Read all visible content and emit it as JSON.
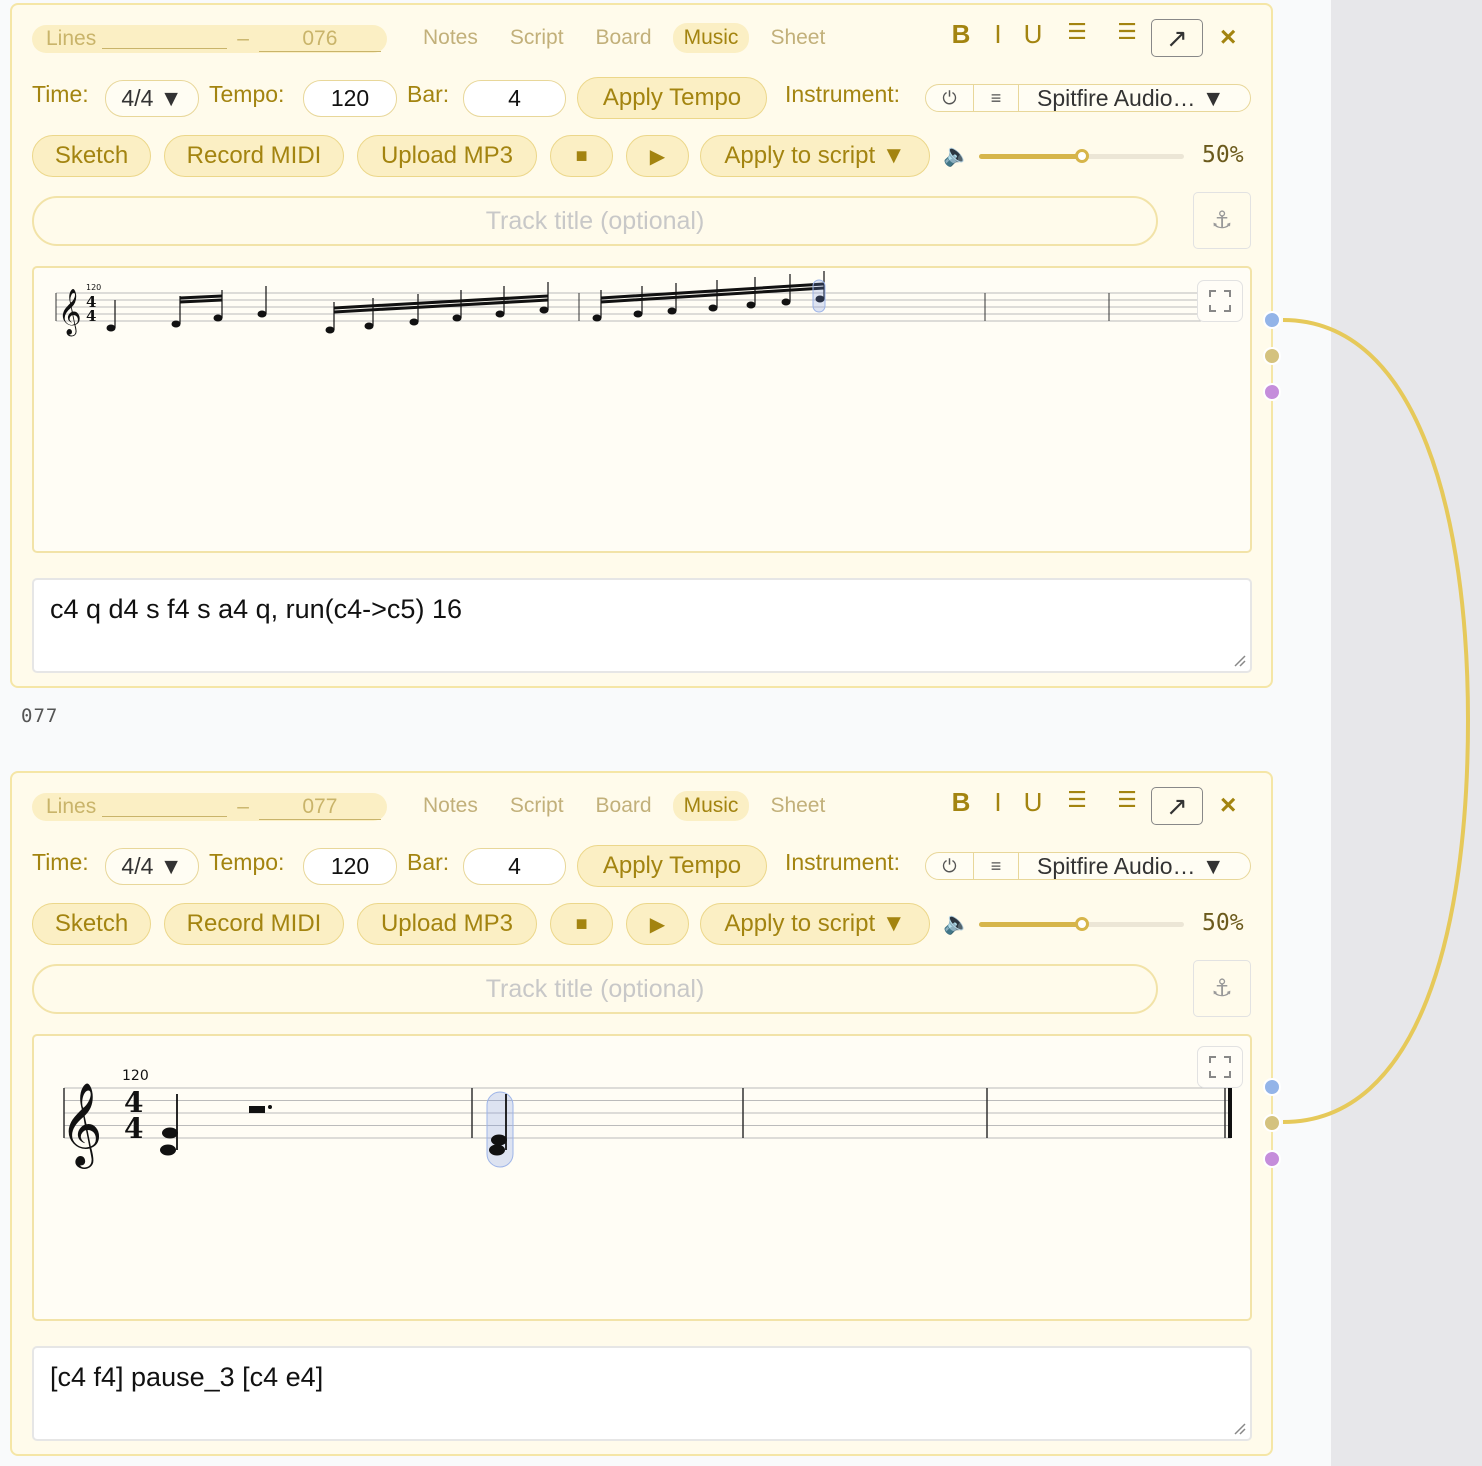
{
  "colors": {
    "accent": "#a38410",
    "pill_bg": "#fbefc4",
    "card_bg": "#fffbeb",
    "connector": "#e6c95a",
    "port_blue": "#93b4e8",
    "port_tan": "#d4c27e",
    "port_purple": "#c58ddb"
  },
  "between_label": "077",
  "cards": [
    {
      "lines_label": "Lines",
      "lines_dash": "–",
      "lines_number": "076",
      "tabs": [
        "Notes",
        "Script",
        "Board",
        "Music",
        "Sheet"
      ],
      "active_tab": "Music",
      "format": {
        "bold": "B",
        "italic": "I",
        "underline": "U",
        "bullet_list_icon": "☰",
        "numbered_list_icon": "☰",
        "popout_icon": "↗",
        "close_icon": "×"
      },
      "time_label": "Time:",
      "time_value": "4/4 ▼",
      "tempo_label": "Tempo:",
      "tempo_value": "120",
      "bar_label": "Bar:",
      "bar_value": "4",
      "apply_tempo": "Apply Tempo",
      "instrument_label": "Instrument:",
      "instrument_power_icon": "⏻",
      "instrument_menu_icon": "≡",
      "instrument_name": "Spitfire Audio… ▼",
      "sketch": "Sketch",
      "record_midi": "Record MIDI",
      "upload_mp3": "Upload MP3",
      "stop_icon": "■",
      "play_icon": "▶",
      "apply_to_script": "Apply to script ▼",
      "volume_icon": "🔈",
      "volume_percent": "50%",
      "volume_level": 0.5,
      "track_title_placeholder": "Track title (optional)",
      "anchor_icon": "⚓",
      "score_tempo": "120",
      "script_text": "c4 q d4 s f4 s a4 q, run(c4->c5) 16"
    },
    {
      "lines_label": "Lines",
      "lines_dash": "–",
      "lines_number": "077",
      "tabs": [
        "Notes",
        "Script",
        "Board",
        "Music",
        "Sheet"
      ],
      "active_tab": "Music",
      "format": {
        "bold": "B",
        "italic": "I",
        "underline": "U",
        "bullet_list_icon": "☰",
        "numbered_list_icon": "☰",
        "popout_icon": "↗",
        "close_icon": "×"
      },
      "time_label": "Time:",
      "time_value": "4/4 ▼",
      "tempo_label": "Tempo:",
      "tempo_value": "120",
      "bar_label": "Bar:",
      "bar_value": "4",
      "apply_tempo": "Apply Tempo",
      "instrument_label": "Instrument:",
      "instrument_power_icon": "⏻",
      "instrument_menu_icon": "≡",
      "instrument_name": "Spitfire Audio… ▼",
      "sketch": "Sketch",
      "record_midi": "Record MIDI",
      "upload_mp3": "Upload MP3",
      "stop_icon": "■",
      "play_icon": "▶",
      "apply_to_script": "Apply to script ▼",
      "volume_icon": "🔈",
      "volume_percent": "50%",
      "volume_level": 0.5,
      "track_title_placeholder": "Track title (optional)",
      "anchor_icon": "⚓",
      "score_tempo": "120",
      "script_text": "[c4 f4] pause_3 [c4 e4]"
    }
  ]
}
